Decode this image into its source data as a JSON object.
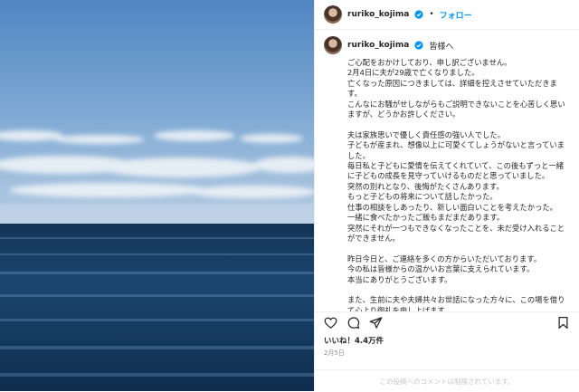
{
  "post": {
    "username": "ruriko_kojima",
    "follow_label": "フォロー",
    "dot": "•",
    "caption_title": "皆様へ",
    "caption_body": "ご心配をおかけしており、申し訳ございません。\n2月4日に夫が29歳で亡くなりました。\n亡くなった原因につきましては、詳細を控えさせていただきます。\nこんなにお騒がせしながらもご説明できないことを心苦しく思いますが、どうかお許しください。\n\n夫は家族思いで優しく責任感の強い人でした。\n子どもが産まれ、想像以上に可愛くてしょうがないと言っていました。\n毎日私と子どもに愛情を伝えてくれていて、この後もずっと一緒に子どもの成長を見守っていけるものだと思っていました。\n突然の別れとなり、後悔がたくさんあります。\nもっと子どもの将来について話したかった。\n仕事の相談をしあったり、新しい面白いことを考えたかった。\n一緒に食べたかったご飯もまだまだあります。\n突然にそれが一つもできなくなったことを、未だ受け入れることができません。\n\n昨日今日と、ご連絡を多くの方からいただいております。\n今の私は皆様からの温かいお言葉に支えられています。\n本当にありがとうございます。\n\nまた、生前に夫や夫婦共々お世話になった方々に、この場を借りて心より御礼を申し上げます。",
    "likes": "いいね！4.4万件",
    "date": "2月5日",
    "comments_disabled": "この投稿へのコメントは制限されています。"
  },
  "icons": {
    "verified": "verified-badge-icon",
    "like": "heart-icon",
    "comment": "comment-icon",
    "share": "send-icon",
    "save": "bookmark-icon"
  },
  "colors": {
    "accent": "#0095f6",
    "text": "#262626",
    "muted": "#8e8e8e"
  }
}
